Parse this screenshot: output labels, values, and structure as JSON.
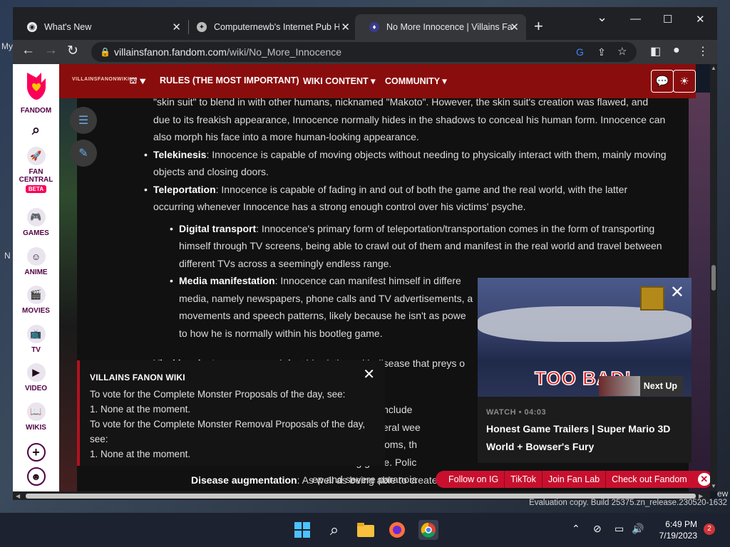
{
  "desktop": {
    "label_my": "My",
    "label_n": "N",
    "label_ew": "ew"
  },
  "browser": {
    "tabs": [
      {
        "title": "What's New",
        "close": "✕"
      },
      {
        "title": "Computernewb's Internet Pub H",
        "close": "✕"
      },
      {
        "title": "No More Innocence | Villains Far",
        "close": "✕"
      }
    ],
    "new_tab": "+",
    "window_controls": {
      "dropdown": "⌄",
      "minimize": "—",
      "maximize": "☐",
      "close": "✕"
    },
    "url_host": "villainsfanon.fandom.com",
    "url_path": "/wiki/No_More_Innocence",
    "nav": {
      "back": "←",
      "forward": "→",
      "reload": "↻"
    }
  },
  "rail": {
    "brand": "FANDOM",
    "items": [
      {
        "label": "FAN",
        "label2": "CENTRAL",
        "badge": "BETA"
      },
      {
        "label": "GAMES"
      },
      {
        "label": "ANIME"
      },
      {
        "label": "MOVIES"
      },
      {
        "label": "TV"
      },
      {
        "label": "VIDEO"
      },
      {
        "label": "WIKIS"
      }
    ]
  },
  "site_header": {
    "wordmark": "VILLAINSFANONWIKI",
    "nav": [
      {
        "label": "RULES (THE MOST IMPORTANT)"
      },
      {
        "label": "WIKI CONTENT ▾"
      },
      {
        "label": "COMMUNITY ▾"
      }
    ]
  },
  "article": {
    "intro": "\"skin suit\" to blend in with other humans, nicknamed \"Makoto\". However, the skin suit's creation was flawed, and due to its freakish appearance, Innocence normally hides in the shadows to conceal his human form. Innocence can also morph his face into a more human-looking appearance.",
    "telekinesis_term": "Telekinesis",
    "telekinesis_text": ": Innocence is capable of moving objects without needing to physically interact with them, mainly moving objects and closing doors.",
    "teleportation_term": "Teleportation",
    "teleportation_text": ": Innocence is capable of fading in and out of both the game and the real world, with the latter occurring whenever Innocence has a strong enough control over his victims' psyche.",
    "digital_term": "Digital transport",
    "digital_text": ": Innocence's primary form of teleportation/transportation comes in the form of transporting himself through TV screens, being able to crawl out of them and manifest in the real world and travel between different TVs across a seemingly endless range.",
    "media_term": "Media manifestation",
    "media_text": ": Innocence can manifest himself in differe",
    "media_line2": "media, namely newspapers, phone calls and TV advertisements, a",
    "media_line3": "movements and speech patterns, likely because he isn't as powe",
    "media_line4": "to how he is normally within his bootleg game.",
    "virokinesis_term": "Virokinesis",
    "virokinesis_text": ": Innocence can infect his victims with disease that preys o",
    "partial_lines": [
      "ce's symptoms include",
      "only appear several wee",
      "sity of the symptoms, th",
      "the bootleg game. Polic",
      "ep and severe paranoia"
    ],
    "disease_term": "Disease augmentation",
    "disease_text": ": As well as being able to create",
    "last_line": "enhance their effectiveness, making his victims' symptoms more severe and leading to their mental"
  },
  "notice": {
    "title": "VILLAINS FANON WIKI",
    "line1": "To vote for the Complete Monster Proposals of the day, see:",
    "line2": "1. None at the moment.",
    "line3": "To vote for the Complete Monster Removal Proposals of the day, see:",
    "line4": "1. None at the moment.",
    "close": "✕"
  },
  "video": {
    "overlay_text": "TOO BAD!",
    "next_up": "Next Up",
    "meta": "WATCH • 04:03",
    "title": "Honest Game Trailers | Super Mario 3D World + Bowser's Fury",
    "close": "✕"
  },
  "social": {
    "items": [
      "Follow on IG",
      "TikTok",
      "Join Fan Lab",
      "Check out Fandom"
    ],
    "close": "✕"
  },
  "watermark": "Evaluation copy. Build 25375.zn_release.230520-1632",
  "taskbar": {
    "time": "6:49 PM",
    "date": "7/19/2023",
    "notifications": "2"
  }
}
